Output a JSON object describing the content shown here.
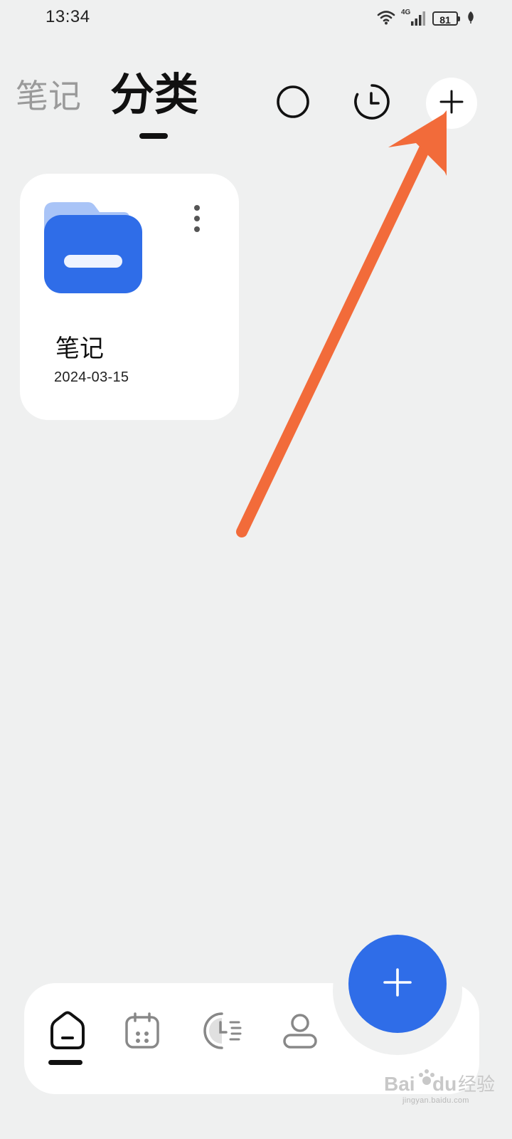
{
  "status_bar": {
    "time": "13:34",
    "network_label": "4G",
    "battery_level": "81",
    "icons": [
      "wifi-icon",
      "signal-icon",
      "battery-icon",
      "leaf-icon"
    ]
  },
  "header": {
    "tabs": [
      {
        "label": "笔记",
        "active": false
      },
      {
        "label": "分类",
        "active": true
      }
    ],
    "actions": [
      "circle-icon",
      "clock-icon",
      "plus-icon"
    ]
  },
  "categories": [
    {
      "name": "笔记",
      "date": "2024-03-15",
      "icon": "folder-icon"
    }
  ],
  "bottom_nav": {
    "items": [
      {
        "icon": "home-icon",
        "active": true
      },
      {
        "icon": "calendar-icon",
        "active": false
      },
      {
        "icon": "timeline-icon",
        "active": false
      },
      {
        "icon": "profile-icon",
        "active": false
      }
    ]
  },
  "fab": {
    "icon": "plus-icon"
  },
  "watermark": {
    "brand": "Bai du 经验",
    "url": "jingyan.baidu.com"
  },
  "colors": {
    "background": "#eff0f0",
    "accent": "#2f6de8",
    "arrow": "#f26b3a",
    "folder_back": "#a9c4f7",
    "folder_front": "#2f6de8"
  }
}
